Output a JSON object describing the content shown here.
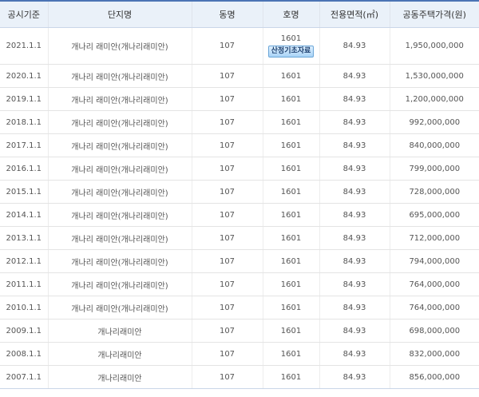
{
  "table": {
    "headers": {
      "date": "공시기준",
      "name": "단지명",
      "dong": "동명",
      "ho": "호명",
      "area": "전용면적(㎡)",
      "price": "공동주택가격(원)"
    },
    "apply_button_label": "산정기초자료",
    "rows": [
      {
        "date": "2021.1.1",
        "name": "개나리 래미안(개나리래미안)",
        "dong": "107",
        "ho": "1601",
        "area": "84.93",
        "price": "1,950,000,000"
      },
      {
        "date": "2020.1.1",
        "name": "개나리 래미안(개나리래미안)",
        "dong": "107",
        "ho": "1601",
        "area": "84.93",
        "price": "1,530,000,000"
      },
      {
        "date": "2019.1.1",
        "name": "개나리 래미안(개나리래미안)",
        "dong": "107",
        "ho": "1601",
        "area": "84.93",
        "price": "1,200,000,000"
      },
      {
        "date": "2018.1.1",
        "name": "개나리 래미안(개나리래미안)",
        "dong": "107",
        "ho": "1601",
        "area": "84.93",
        "price": "992,000,000"
      },
      {
        "date": "2017.1.1",
        "name": "개나리 래미안(개나리래미안)",
        "dong": "107",
        "ho": "1601",
        "area": "84.93",
        "price": "840,000,000"
      },
      {
        "date": "2016.1.1",
        "name": "개나리 래미안(개나리래미안)",
        "dong": "107",
        "ho": "1601",
        "area": "84.93",
        "price": "799,000,000"
      },
      {
        "date": "2015.1.1",
        "name": "개나리 래미안(개나리래미안)",
        "dong": "107",
        "ho": "1601",
        "area": "84.93",
        "price": "728,000,000"
      },
      {
        "date": "2014.1.1",
        "name": "개나리 래미안(개나리래미안)",
        "dong": "107",
        "ho": "1601",
        "area": "84.93",
        "price": "695,000,000"
      },
      {
        "date": "2013.1.1",
        "name": "개나리 래미안(개나리래미안)",
        "dong": "107",
        "ho": "1601",
        "area": "84.93",
        "price": "712,000,000"
      },
      {
        "date": "2012.1.1",
        "name": "개나리 래미안(개나리래미안)",
        "dong": "107",
        "ho": "1601",
        "area": "84.93",
        "price": "794,000,000"
      },
      {
        "date": "2011.1.1",
        "name": "개나리 래미안(개나리래미안)",
        "dong": "107",
        "ho": "1601",
        "area": "84.93",
        "price": "764,000,000"
      },
      {
        "date": "2010.1.1",
        "name": "개나리 래미안(개나리래미안)",
        "dong": "107",
        "ho": "1601",
        "area": "84.93",
        "price": "764,000,000"
      },
      {
        "date": "2009.1.1",
        "name": "개나리래미안",
        "dong": "107",
        "ho": "1601",
        "area": "84.93",
        "price": "698,000,000"
      },
      {
        "date": "2008.1.1",
        "name": "개나리래미안",
        "dong": "107",
        "ho": "1601",
        "area": "84.93",
        "price": "832,000,000"
      },
      {
        "date": "2007.1.1",
        "name": "개나리래미안",
        "dong": "107",
        "ho": "1601",
        "area": "84.93",
        "price": "856,000,000"
      }
    ]
  }
}
